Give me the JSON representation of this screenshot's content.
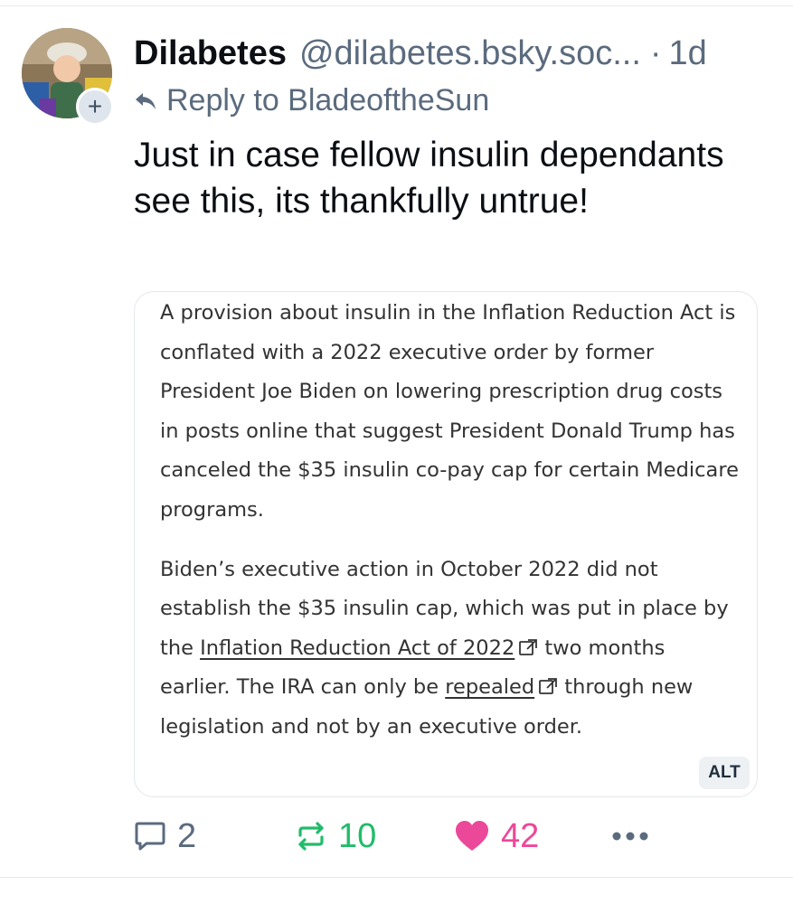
{
  "post": {
    "display_name": "Dilabetes",
    "handle": "@dilabetes.bsky.soc...",
    "separator": "·",
    "time": "1d",
    "reply_prefix": "Reply to BladeoftheSun",
    "text": "Just in case fellow insulin dependants see this, its thankfully untrue!",
    "avatar_icon": "profile-photo",
    "follow_symbol": "+"
  },
  "embed": {
    "paragraph1": "A provision about insulin in the Inflation Reduction Act is conflated with a 2022 executive order by former President Joe Biden on lowering prescription drug costs in posts online that suggest President Donald Trump has canceled the $35 insulin co-pay cap for certain Medicare programs.",
    "p2_part1": "Biden’s executive action in October 2022 did not establish the $35 insulin cap, which was put in place by the ",
    "p2_link1": "Inflation Reduction Act of 2022",
    "p2_part2": " two months earlier. The IRA can only be ",
    "p2_link2": "repealed",
    "p2_part3": " through new legislation and not by an executive order.",
    "alt_label": "ALT"
  },
  "actions": {
    "reply_count": "2",
    "repost_count": "10",
    "like_count": "42",
    "more_symbol": "•••"
  },
  "colors": {
    "muted": "#5b6b7e",
    "repost_green": "#20bc6a",
    "like_pink": "#ec4899",
    "border": "#e4e7eb"
  }
}
